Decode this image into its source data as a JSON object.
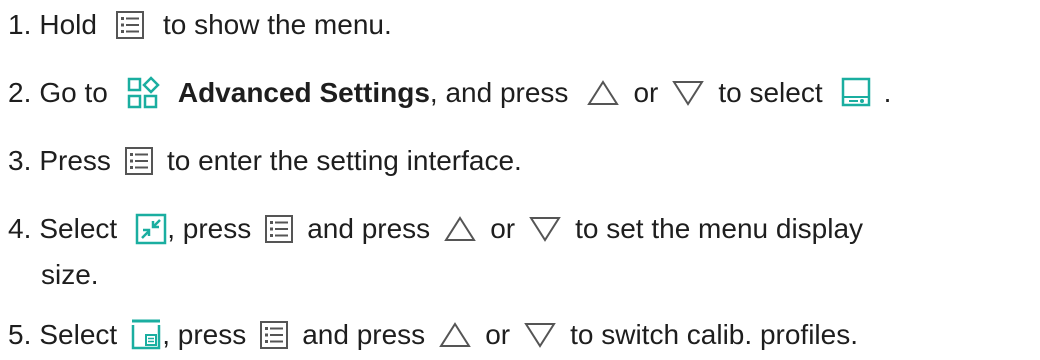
{
  "colors": {
    "text": "#1e1e1e",
    "icon_gray": "#555555",
    "icon_teal": "#1aaea0"
  },
  "icons": {
    "menu": "menu-icon",
    "advanced_settings": "advanced-settings-icon",
    "up": "up-triangle-icon",
    "down": "down-triangle-icon",
    "display": "display-icon",
    "resize": "resize-icon",
    "calib": "calibration-profile-icon"
  },
  "steps": [
    {
      "number": "1.",
      "parts": [
        "Hold",
        "to show the menu."
      ]
    },
    {
      "number": "2.",
      "parts": [
        "Go to",
        "Advanced Settings",
        ", and press",
        "or",
        "to select",
        "."
      ]
    },
    {
      "number": "3.",
      "parts": [
        "Press",
        "to enter the setting interface."
      ]
    },
    {
      "number": "4.",
      "parts": [
        "Select",
        ", press",
        "and press",
        "or",
        "to set the menu display",
        "size."
      ]
    },
    {
      "number": "5.",
      "parts": [
        "Select",
        ", press",
        "and press",
        "or",
        "to switch calib. profiles."
      ]
    }
  ]
}
